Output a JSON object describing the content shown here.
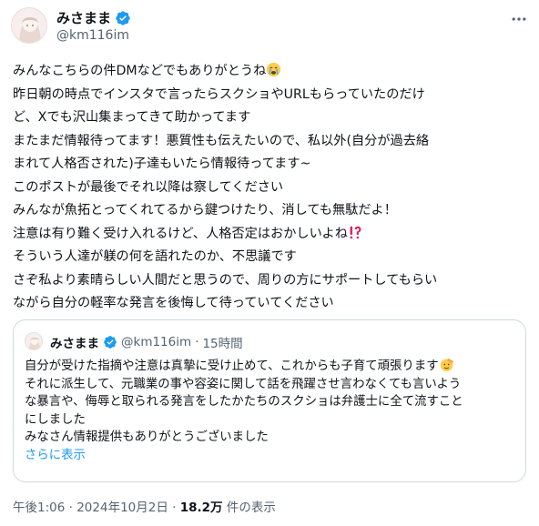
{
  "author": {
    "display_name": "みさまま",
    "handle": "@km116im"
  },
  "tweet_lines": [
    "みんなこちらの件DMなどでもありがとうね",
    "昨日朝の時点でインスタで言ったらスクショやURLもらっていたのだけ",
    "ど、Xでも沢山集まってきて助かってます",
    "またまだ情報待ってます！悪質性も伝えたいので、私以外(自分が過去絡",
    "まれて人格否された)子達もいたら情報待ってます~",
    "このポストが最後でそれ以降は察してください",
    "みんなが魚拓とってくれてるから鍵つけたり、消しても無駄だよ！",
    "注意は有り難く受け入れるけど、人格否定はおかしいよね",
    "そういう人達が躾の何を語れたのか、不思議です",
    "さぞ私より素晴らしい人間だと思うので、周りの方にサポートしてもらい",
    "ながら自分の軽率な発言を後悔して待っていてください"
  ],
  "quote": {
    "display_name": "みさまま",
    "handle": "@km116im",
    "separator": "·",
    "time": "15時間",
    "lines": [
      "自分が受けた指摘や注意は真摯に受け止めて、これからも子育て頑張ります",
      "それに派生して、元職業の事や容姿に関して話を飛躍させ言わなくても言いよう",
      "な暴言や、侮辱と取られる発言をしたかたちのスクショは弁護士に全て流すこと",
      "にしました",
      "みなさん情報提供もありがとうございました"
    ],
    "show_more": "さらに表示"
  },
  "meta": {
    "time": "午後1:06",
    "separator": "·",
    "date": "2024年10月2日",
    "views": "18.2万",
    "views_suffix": "件の表示"
  },
  "colors": {
    "text": "#0f1419",
    "secondary": "#536471",
    "link": "#1d9bf0",
    "border": "#cfd9de",
    "verified": "#1d9bf0"
  },
  "icons": [
    "verified-badge-icon",
    "more-options-icon",
    "crying-face-emoji",
    "exclamation-question-emoji",
    "salute-face-emoji"
  ]
}
